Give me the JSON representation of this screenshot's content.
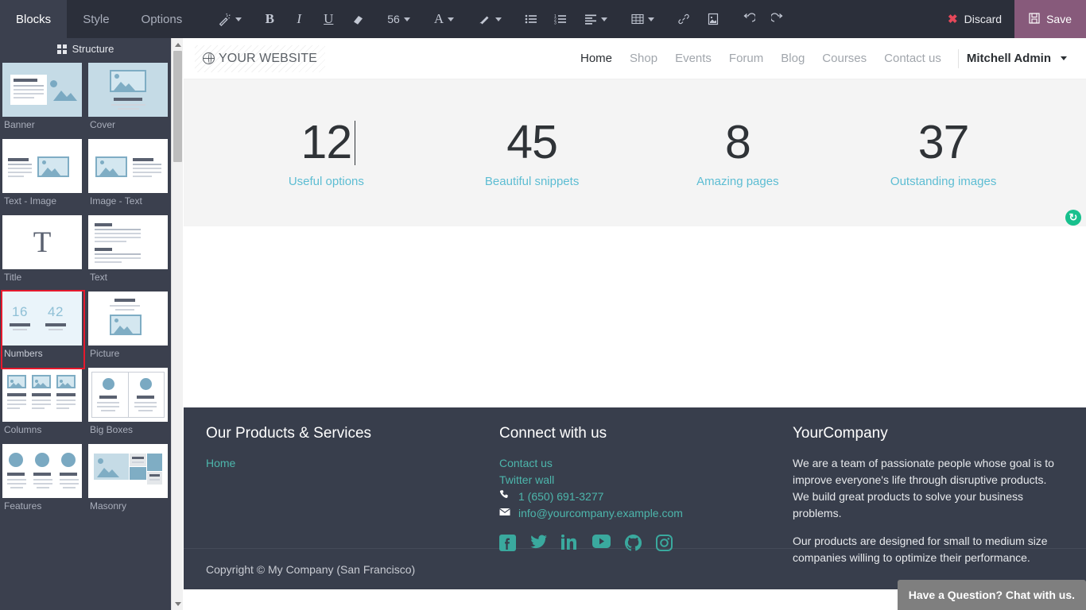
{
  "toolbar": {
    "tabs": [
      {
        "label": "Blocks",
        "active": true
      },
      {
        "label": "Style",
        "active": false
      },
      {
        "label": "Options",
        "active": false
      }
    ],
    "tools": {
      "style_picker": "magic-wand",
      "bold": "B",
      "italic": "I",
      "underline": "U",
      "clear_format": "eraser",
      "font_size": "56",
      "font_color": "A",
      "background_color": "paintbrush",
      "unordered_list": "bullet-list",
      "ordered_list": "numbered-list",
      "align": "align-left",
      "table": "table",
      "link": "link",
      "image": "image",
      "undo": "undo",
      "redo": "redo"
    },
    "discard_label": "Discard",
    "save_label": "Save",
    "save_bg": "#875a7b",
    "discard_icon_color": "#e6485a"
  },
  "sidebar": {
    "header": "Structure",
    "blocks": [
      {
        "label": "Banner",
        "thumb": "banner",
        "selected": false
      },
      {
        "label": "Cover",
        "thumb": "cover",
        "selected": false
      },
      {
        "label": "Text - Image",
        "thumb": "text-image",
        "selected": false
      },
      {
        "label": "Image - Text",
        "thumb": "image-text",
        "selected": false
      },
      {
        "label": "Title",
        "thumb": "title",
        "selected": false
      },
      {
        "label": "Text",
        "thumb": "text",
        "selected": false
      },
      {
        "label": "Numbers",
        "thumb": "numbers",
        "selected": true
      },
      {
        "label": "Picture",
        "thumb": "picture",
        "selected": false
      },
      {
        "label": "Columns",
        "thumb": "columns",
        "selected": false
      },
      {
        "label": "Big Boxes",
        "thumb": "big-boxes",
        "selected": false
      },
      {
        "label": "Features",
        "thumb": "features",
        "selected": false
      },
      {
        "label": "Masonry",
        "thumb": "masonry",
        "selected": false
      }
    ],
    "numbers_thumb_values": [
      "16",
      "42"
    ],
    "selection_color": "#e6192d"
  },
  "site": {
    "brand": "YOUR WEBSITE",
    "nav": [
      {
        "label": "Home",
        "active": true
      },
      {
        "label": "Shop",
        "active": false
      },
      {
        "label": "Events",
        "active": false
      },
      {
        "label": "Forum",
        "active": false
      },
      {
        "label": "Blog",
        "active": false
      },
      {
        "label": "Courses",
        "active": false
      },
      {
        "label": "Contact us",
        "active": false
      }
    ],
    "user": "Mitchell Admin"
  },
  "numbers_block": {
    "items": [
      {
        "value": "12",
        "caption": "Useful options",
        "editing": true
      },
      {
        "value": "45",
        "caption": "Beautiful snippets",
        "editing": false
      },
      {
        "value": "8",
        "caption": "Amazing pages",
        "editing": false
      },
      {
        "value": "37",
        "caption": "Outstanding images",
        "editing": false
      }
    ],
    "caption_color": "#5dbdd3",
    "band_bg": "#f4f4f4"
  },
  "reload_badge": {
    "icon": "refresh-icon",
    "glyph": "↻",
    "color": "#17c08d"
  },
  "footer": {
    "col1": {
      "title": "Our Products & Services",
      "links": [
        "Home"
      ]
    },
    "col2": {
      "title": "Connect with us",
      "links": [
        "Contact us",
        "Twitter wall"
      ],
      "phone": "1 (650) 691-3277",
      "email": "info@yourcompany.example.com",
      "socials": [
        "facebook",
        "twitter",
        "linkedin",
        "youtube",
        "github",
        "instagram"
      ]
    },
    "col3": {
      "title": "YourCompany",
      "paragraphs": [
        "We are a team of passionate people whose goal is to improve everyone's life through disruptive products. We build great products to solve your business problems.",
        "Our products are designed for small to medium size companies willing to optimize their performance."
      ]
    },
    "copyright": "Copyright © My Company (San Francisco)",
    "bg": "#383e4c",
    "link_color": "#4db6ac"
  },
  "chat": {
    "label": "Have a Question? Chat with us."
  }
}
